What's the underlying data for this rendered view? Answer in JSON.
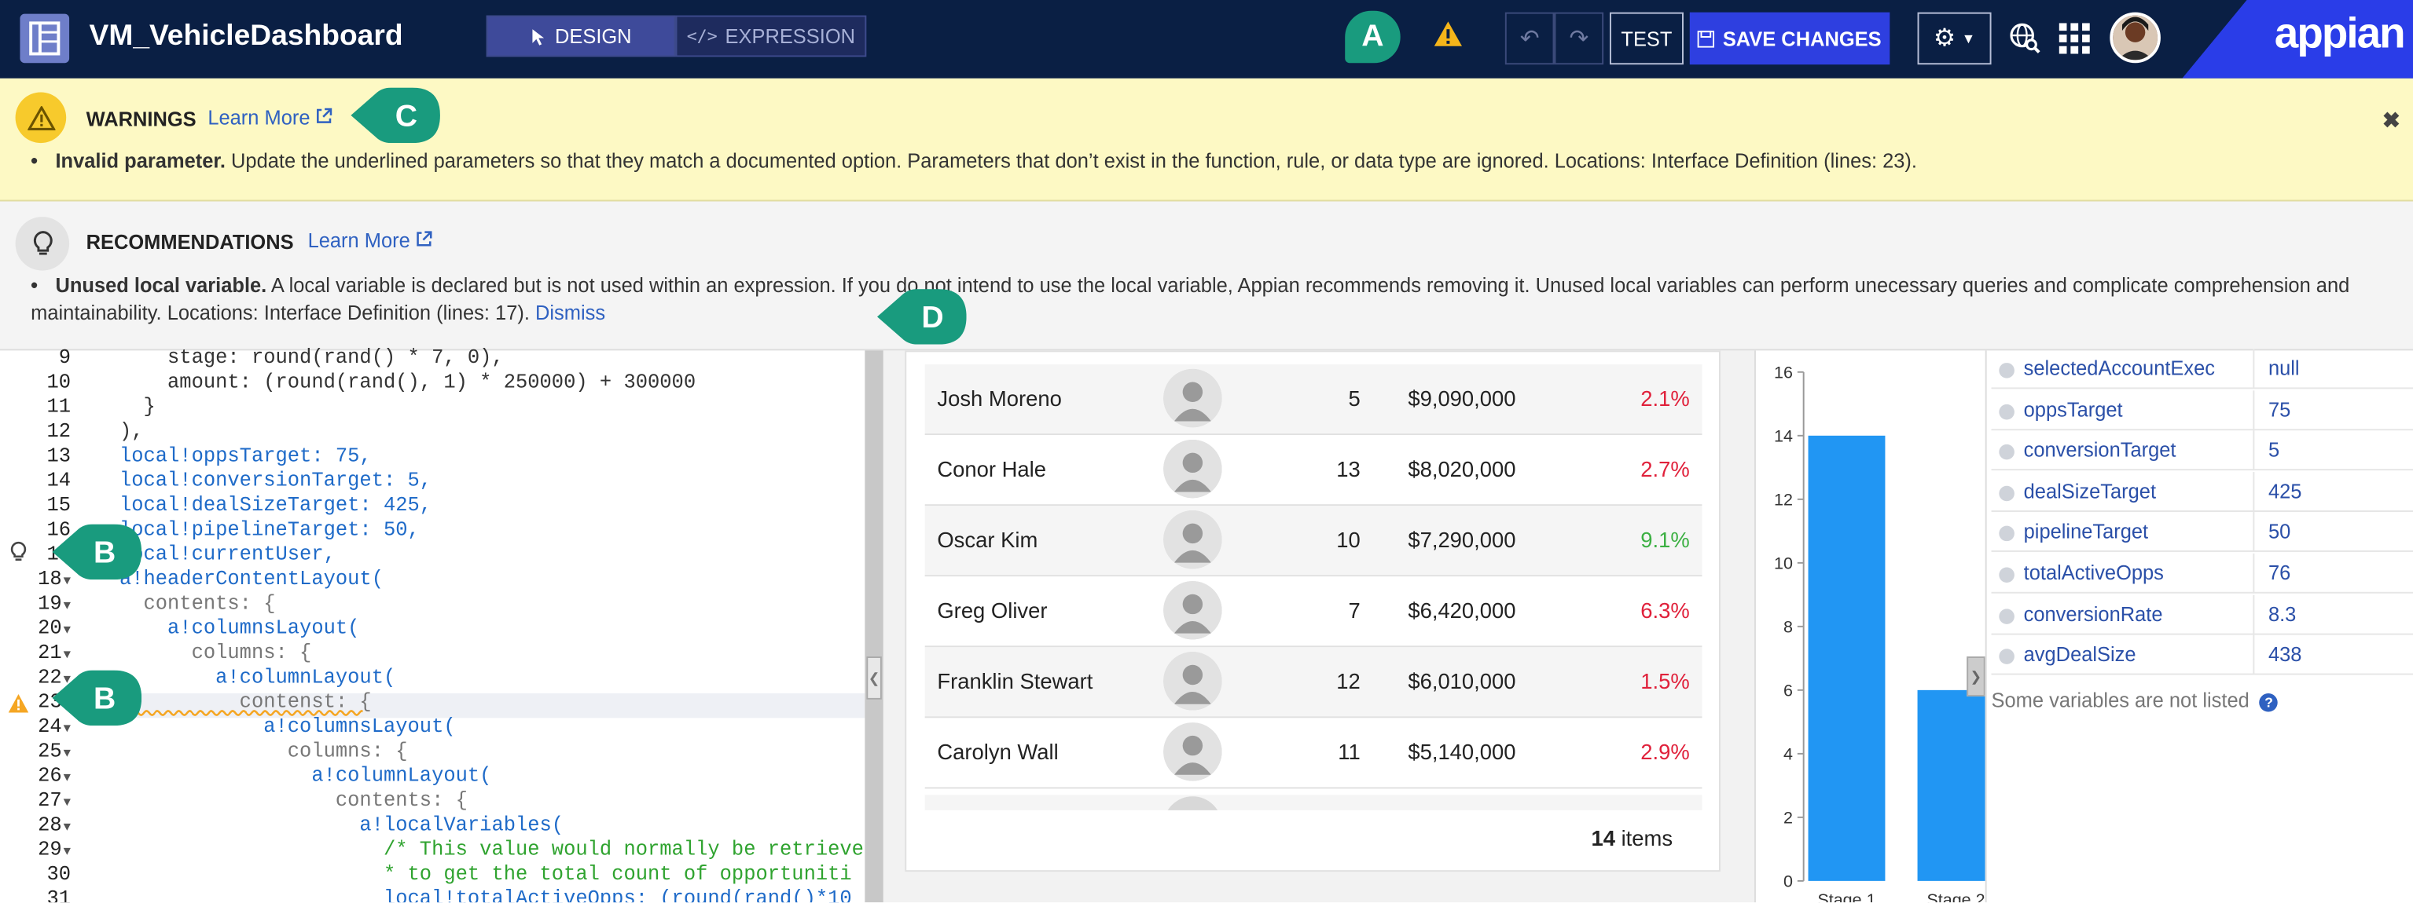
{
  "header": {
    "app_title": "VM_VehicleDashboard",
    "modes": {
      "design": "DESIGN",
      "expression": "EXPRESSION"
    },
    "marker_a": "A",
    "test_label": "TEST",
    "save_label": "SAVE CHANGES",
    "brand": "appian",
    "colors": {
      "bar": "#0a1f44",
      "save": "#2e3fe0",
      "active_mode": "#3e4a9a",
      "marker": "#199b7e"
    }
  },
  "warnings": {
    "heading": "WARNINGS",
    "learn_more": "Learn More",
    "marker": "C",
    "bullet_title": "Invalid parameter.",
    "bullet_text": " Update the underlined parameters so that they match a documented option. Parameters that don’t exist in the function, rule, or data type are ignored. Locations: Interface Definition (lines: 23)."
  },
  "recommendations": {
    "heading": "RECOMMENDATIONS",
    "learn_more": "Learn More",
    "bullet_title": "Unused local variable.",
    "bullet_text": " A local variable is declared but is not used within an expression. If you do not intend to use the local variable, Appian recommends removing it. Unused local variables can perform unecessary queries and complicate comprehension and maintainability. Locations: Interface Definition (lines: 17).",
    "dismiss": "Dismiss",
    "marker": "D"
  },
  "editor": {
    "markers": [
      "B",
      "B"
    ],
    "lines": [
      {
        "n": "9",
        "fold": false,
        "code": "      stage: round(rand() * 7, 0),"
      },
      {
        "n": "10",
        "fold": false,
        "code": "      amount: (round(rand(), 1) * 250000) + 300000"
      },
      {
        "n": "11",
        "fold": false,
        "code": "    }"
      },
      {
        "n": "12",
        "fold": false,
        "code": "  ),"
      },
      {
        "n": "13",
        "fold": false,
        "code": "  local!oppsTarget: 75,"
      },
      {
        "n": "14",
        "fold": false,
        "code": "  local!conversionTarget: 5,"
      },
      {
        "n": "15",
        "fold": false,
        "code": "  local!dealSizeTarget: 425,"
      },
      {
        "n": "16",
        "fold": false,
        "code": "  local!pipelineTarget: 50,"
      },
      {
        "n": "17",
        "fold": false,
        "code": "  local!currentUser,"
      },
      {
        "n": "18",
        "fold": true,
        "code": "  a!headerContentLayout("
      },
      {
        "n": "19",
        "fold": true,
        "code": "    contents: {"
      },
      {
        "n": "20",
        "fold": true,
        "code": "      a!columnsLayout("
      },
      {
        "n": "21",
        "fold": true,
        "code": "        columns: {"
      },
      {
        "n": "22",
        "fold": true,
        "code": "          a!columnLayout("
      },
      {
        "n": "23",
        "fold": true,
        "code": "            contenst: {"
      },
      {
        "n": "24",
        "fold": true,
        "code": "              a!columnsLayout("
      },
      {
        "n": "25",
        "fold": true,
        "code": "                columns: {"
      },
      {
        "n": "26",
        "fold": true,
        "code": "                  a!columnLayout("
      },
      {
        "n": "27",
        "fold": true,
        "code": "                    contents: {"
      },
      {
        "n": "28",
        "fold": true,
        "code": "                      a!localVariables("
      },
      {
        "n": "29",
        "fold": true,
        "code": "                        /* This value would normally be retrieve"
      },
      {
        "n": "30",
        "fold": false,
        "code": "                        * to get the total count of opportuniti"
      },
      {
        "n": "31",
        "fold": false,
        "code": "                        local!totalActiveOpps: (round(rand()*10"
      }
    ]
  },
  "grid": {
    "rows": [
      {
        "name": "Josh Moreno",
        "count": "5",
        "amount": "$9,090,000",
        "pct": "2.1%",
        "pct_color": "#e0213b"
      },
      {
        "name": "Conor Hale",
        "count": "13",
        "amount": "$8,020,000",
        "pct": "2.7%",
        "pct_color": "#e0213b"
      },
      {
        "name": "Oscar Kim",
        "count": "10",
        "amount": "$7,290,000",
        "pct": "9.1%",
        "pct_color": "#3cb043"
      },
      {
        "name": "Greg Oliver",
        "count": "7",
        "amount": "$6,420,000",
        "pct": "6.3%",
        "pct_color": "#e0213b"
      },
      {
        "name": "Franklin Stewart",
        "count": "12",
        "amount": "$6,010,000",
        "pct": "1.5%",
        "pct_color": "#e0213b"
      },
      {
        "name": "Carolyn Wall",
        "count": "11",
        "amount": "$5,140,000",
        "pct": "2.9%",
        "pct_color": "#e0213b"
      }
    ],
    "items_count": "14",
    "items_label": " items"
  },
  "chart_data": {
    "type": "bar",
    "categories": [
      "Stage 1",
      "Stage 2"
    ],
    "values": [
      14,
      6
    ],
    "yticks": [
      "0",
      "2",
      "4",
      "6",
      "8",
      "10",
      "12",
      "14",
      "16"
    ],
    "ylim": [
      0,
      16
    ],
    "color": "#2196f3"
  },
  "variables": {
    "rows": [
      {
        "name": "selectedAccountExec",
        "value": "null"
      },
      {
        "name": "oppsTarget",
        "value": "75"
      },
      {
        "name": "conversionTarget",
        "value": "5"
      },
      {
        "name": "dealSizeTarget",
        "value": "425"
      },
      {
        "name": "pipelineTarget",
        "value": "50"
      },
      {
        "name": "totalActiveOpps",
        "value": "76"
      },
      {
        "name": "conversionRate",
        "value": "8.3"
      },
      {
        "name": "avgDealSize",
        "value": "438"
      }
    ],
    "note": "Some variables are not listed"
  }
}
